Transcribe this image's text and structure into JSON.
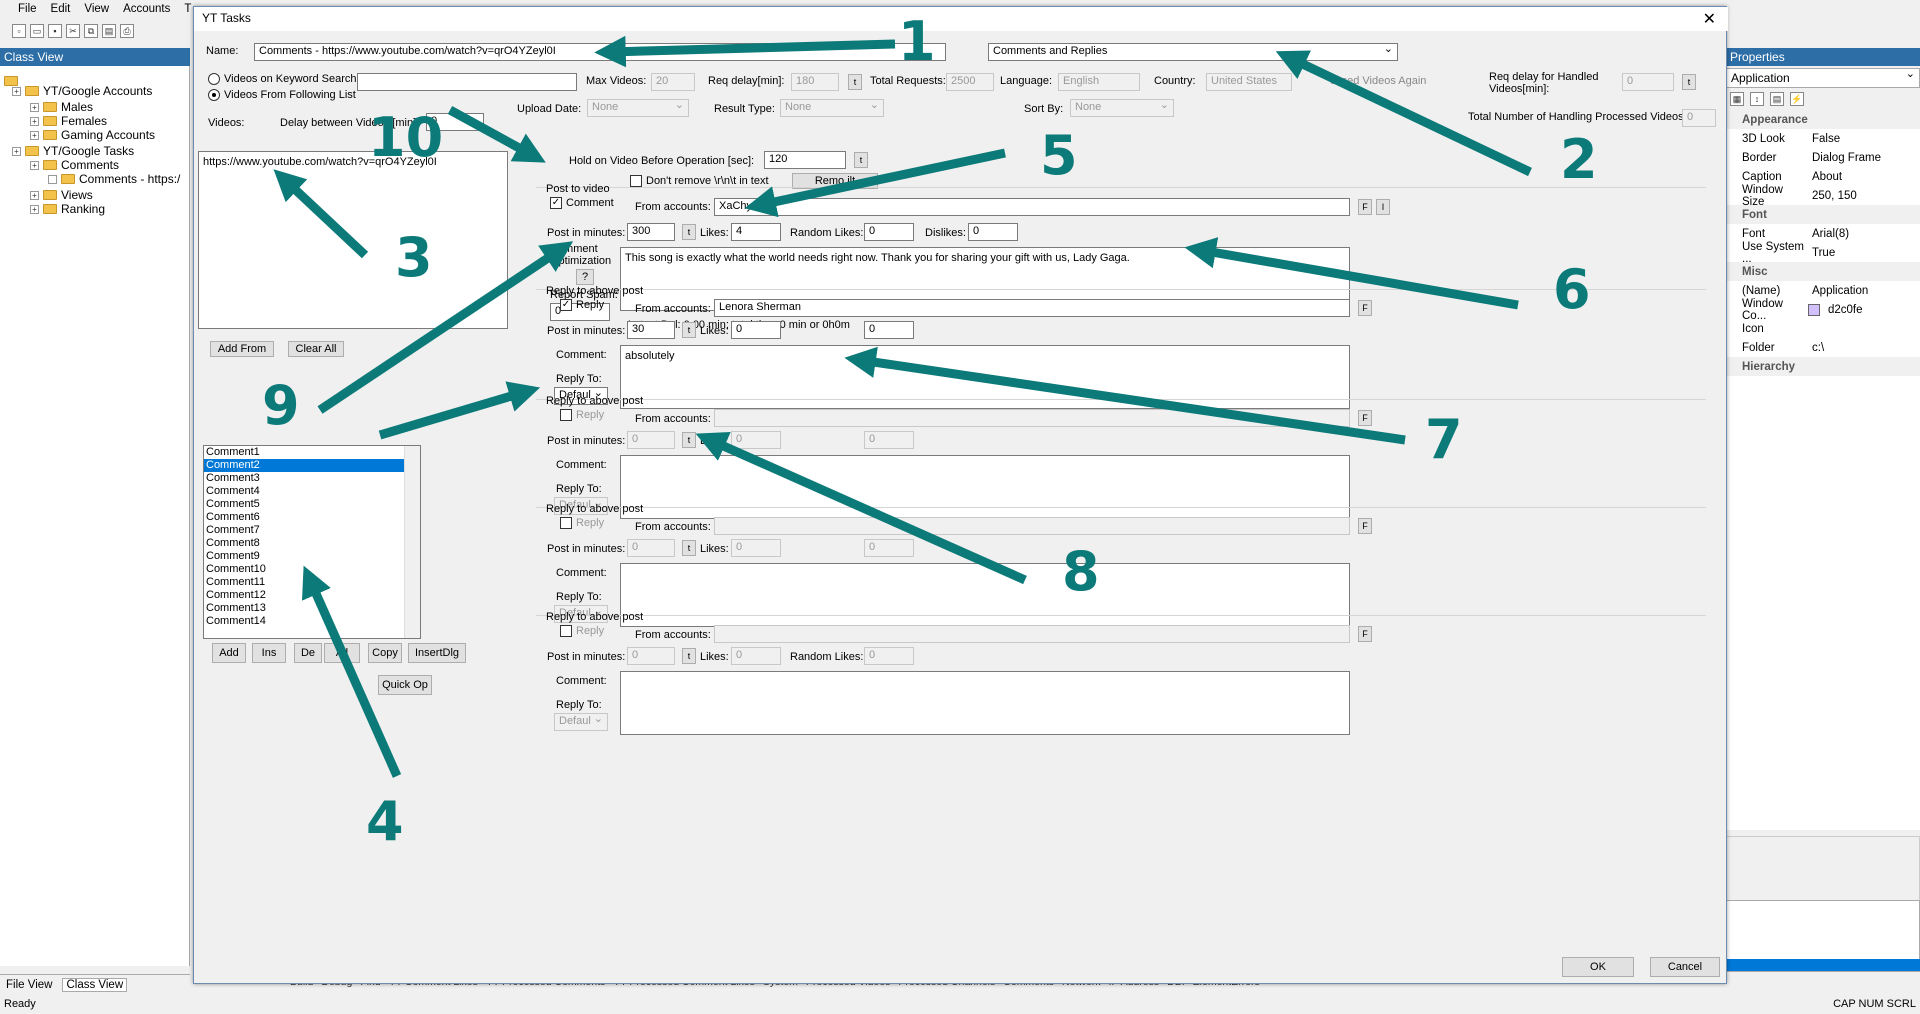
{
  "app": {
    "menu": [
      "File",
      "Edit",
      "View",
      "Accounts",
      "T"
    ],
    "status_left": "Ready",
    "status_right": "CAP  NUM  SCRL"
  },
  "class_view": {
    "title": "Class View",
    "tree": [
      {
        "label": "YT/Google Accounts",
        "level": 0
      },
      {
        "label": "Males",
        "level": 1
      },
      {
        "label": "Females",
        "level": 1
      },
      {
        "label": "Gaming Accounts",
        "level": 1
      },
      {
        "label": "YT/Google Tasks",
        "level": 0
      },
      {
        "label": "Comments",
        "level": 1
      },
      {
        "label": "Comments - https:/",
        "level": 2
      },
      {
        "label": "Views",
        "level": 1
      },
      {
        "label": "Ranking",
        "level": 1
      }
    ],
    "tabs": [
      "File View",
      "Class View"
    ]
  },
  "bottom_tabs": [
    "Build",
    "Debug",
    "Find",
    "YT Comment Likes",
    "YT Processed Comments",
    "YT Processed Comment Likes",
    "System",
    "Processed Videos",
    "Processed Channels",
    "Comments",
    "Network",
    "IP Address",
    "DBI",
    "ElementErrors"
  ],
  "properties": {
    "title": "Properties",
    "combo": "Application",
    "rows": [
      {
        "name": "Appearance",
        "value": "",
        "cat": true
      },
      {
        "name": "3D Look",
        "value": "False"
      },
      {
        "name": "Border",
        "value": "Dialog Frame"
      },
      {
        "name": "Caption",
        "value": "About"
      },
      {
        "name": "Window Size",
        "value": "250, 150"
      },
      {
        "name": "Font",
        "value": "",
        "cat": true
      },
      {
        "name": "Font",
        "value": "Arial(8)"
      },
      {
        "name": "Use System ...",
        "value": "True"
      },
      {
        "name": "Misc",
        "value": "",
        "cat": true
      },
      {
        "name": "(Name)",
        "value": "Application"
      },
      {
        "name": "Window Co...",
        "value": "d2c0fe"
      },
      {
        "name": "Icon",
        "value": ""
      },
      {
        "name": "Folder",
        "value": "c:\\"
      },
      {
        "name": "Hierarchy",
        "value": "",
        "cat": true
      }
    ],
    "swatch": "#d2c0fe"
  },
  "dialog": {
    "title": "YT Tasks",
    "name_label": "Name:",
    "name_value": "Comments - https://www.youtube.com/watch?v=qrO4YZeyl0I",
    "task_type": "Comments and Replies",
    "radio_keyword": "Videos on Keyword Search",
    "radio_list": "Videos From Following List",
    "max_videos_label": "Max Videos:",
    "max_videos": "20",
    "req_delay_label": "Req delay[min]:",
    "req_delay": "180",
    "total_req_label": "Total Requests:",
    "total_req": "2500",
    "language_label": "Language:",
    "language": "English",
    "country_label": "Country:",
    "country": "United States",
    "processed_again": "essed Videos Again",
    "req_handled_label": "Req delay for Handled Videos[min]:",
    "req_handled": "0",
    "total_handling_label": "Total Number of Handling Processed Videos:",
    "total_handling": "0",
    "videos_label": "Videos:",
    "delay_between_label": "Delay between Videos [min]:",
    "delay_between": "0",
    "upload_label": "Upload Date:",
    "upload": "None",
    "result_label": "Result Type:",
    "result": "None",
    "sort_label": "Sort By:",
    "sort": "None",
    "hold_label": "Hold on Video Before Operation [sec]:",
    "hold": "120",
    "dont_remove": "Don't remove \\r\\n\\t in text",
    "remove_btn": "Remo      ilt",
    "video_url": "https://www.youtube.com/watch?v=qrO4YZeyl0I",
    "add_from": "Add From",
    "clear_all": "Clear All",
    "comments_list": [
      "Comment1",
      "Comment2",
      "Comment3",
      "Comment4",
      "Comment5",
      "Comment6",
      "Comment7",
      "Comment8",
      "Comment9",
      "Comment10",
      "Comment11",
      "Comment12",
      "Comment13",
      "Comment14"
    ],
    "list_buttons": {
      "add": "Add",
      "ins": "Ins",
      "del": "De",
      "all": "All",
      "copy": "Copy",
      "insertdlg": "InsertDlg",
      "quickop": "Quick Op"
    },
    "post": {
      "group": "Post to video",
      "check": "Comment",
      "from_label": "From accounts:",
      "from": "XaChy",
      "post_min_label": "Post in minutes:",
      "post_min": "300",
      "likes_label": "Likes:",
      "likes": "4",
      "rlikes_label": "Random Likes:",
      "rlikes": "0",
      "dislikes_label": "Dislikes:",
      "dislikes": "0",
      "comment_label": "Comment",
      "optim_label": "Optimization",
      "report_label": "Report Spam:",
      "report": "0",
      "text": "This song is exactly what the world needs right now. Thank you for sharing your gift with us, Lady Gaga.",
      "latest": "Latest Del: 0.00 min;   total time 0 min or 0h0m"
    },
    "reply1": {
      "group": "Reply to above post",
      "check": "Reply",
      "from_label": "From accounts:",
      "from": "Lenora Sherman",
      "post_min_label": "Post in minutes:",
      "post_min": "30",
      "likes_label": "Likes:",
      "likes": "0",
      "third": "0",
      "comment_label": "Comment:",
      "text": "absolutely",
      "reply_to_label": "Reply To:",
      "reply_to": "Defaul"
    },
    "reply2": {
      "group": "Reply to above post",
      "check": "Reply",
      "from_label": "From accounts:",
      "post_min_label": "Post in minutes:",
      "post_min": "0",
      "likes_label": "Likes:",
      "likes": "0",
      "third": "0",
      "comment_label": "Comment:",
      "reply_to_label": "Reply To:",
      "reply_to": "Defaul"
    },
    "reply3": {
      "group": "Reply to above post",
      "check": "Reply",
      "from_label": "From accounts:",
      "post_min_label": "Post in minutes:",
      "post_min": "0",
      "likes_label": "Likes:",
      "likes": "0",
      "third": "0",
      "comment_label": "Comment:",
      "reply_to_label": "Reply To:",
      "reply_to": "Defaul"
    },
    "reply4": {
      "group": "Reply to above post",
      "check": "Reply",
      "from_label": "From accounts:",
      "post_min_label": "Post in minutes:",
      "post_min": "0",
      "likes_label": "Likes:",
      "likes": "0",
      "rlikes_label": "Random Likes:",
      "rlikes": "0",
      "comment_label": "Comment:",
      "reply_to_label": "Reply To:",
      "reply_to": "Defaul"
    },
    "ok": "OK",
    "cancel": "Cancel"
  },
  "annotations": {
    "color": "#0b7a78",
    "numbers": [
      "1",
      "2",
      "3",
      "4",
      "5",
      "6",
      "7",
      "8",
      "9",
      "10"
    ]
  }
}
